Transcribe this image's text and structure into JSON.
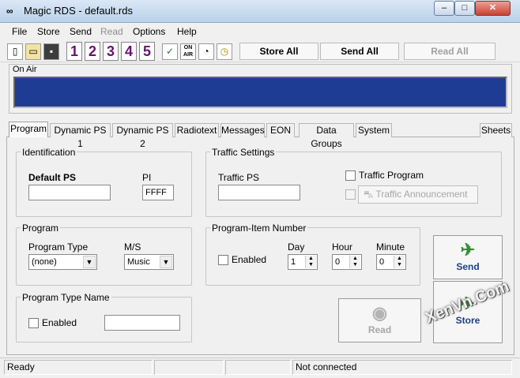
{
  "window": {
    "title": "Magic RDS - default.rds",
    "app_icon": "∞",
    "min": "–",
    "max": "□",
    "close": "✕"
  },
  "menu": [
    "File",
    "Store",
    "Send",
    "Read",
    "Options",
    "Help"
  ],
  "toolbar": {
    "icons": [
      "new-icon",
      "open-icon",
      "save-icon"
    ],
    "numbers": [
      "1",
      "2",
      "3",
      "4",
      "5"
    ],
    "tool_icons": [
      "check-icon",
      "on-air-icon",
      "clock-settings-icon",
      "clock-icon"
    ],
    "on_air_icon_text": "ON AIR",
    "store_all": "Store All",
    "send_all": "Send All",
    "read_all": "Read All"
  },
  "on_air": {
    "label": "On Air",
    "display_color": "#1f3c95"
  },
  "tabs": [
    "Program",
    "Dynamic PS 1",
    "Dynamic PS 2",
    "Radiotext",
    "Messages",
    "EON",
    "Data Groups",
    "System"
  ],
  "sheets_button": "Sheets",
  "identification": {
    "title": "Identification",
    "default_ps_label": "Default PS",
    "default_ps_value": "",
    "pi_label": "PI",
    "pi_value": "FFFF"
  },
  "traffic": {
    "title": "Traffic Settings",
    "traffic_ps_label": "Traffic PS",
    "traffic_ps_value": "",
    "traffic_program_label": "Traffic Program",
    "traffic_announcement_label": "Traffic Announcement"
  },
  "program": {
    "title": "Program",
    "type_label": "Program Type",
    "type_value": "(none)",
    "ms_label": "M/S",
    "ms_value": "Music"
  },
  "program_item": {
    "title": "Program-Item Number",
    "enabled_label": "Enabled",
    "day_label": "Day",
    "day_value": "1",
    "hour_label": "Hour",
    "hour_value": "0",
    "minute_label": "Minute",
    "minute_value": "0"
  },
  "program_type_name": {
    "title": "Program Type Name",
    "enabled_label": "Enabled",
    "value": ""
  },
  "buttons": {
    "send": "Send",
    "store": "Store",
    "read": "Read"
  },
  "status": {
    "ready": "Ready",
    "pane2": "",
    "pane3": "",
    "connection": "Not connected"
  },
  "watermark": "XenVn.Com"
}
